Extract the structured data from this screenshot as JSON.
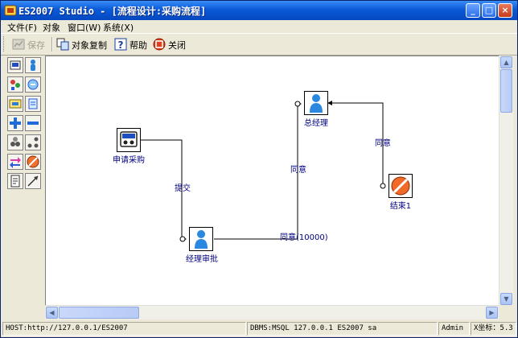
{
  "window": {
    "title": "ES2007 Studio - [流程设计:采购流程]",
    "minimize_glyph": "_",
    "maximize_glyph": "□",
    "close_glyph": "×"
  },
  "menu": [
    "文件(F)",
    "对象",
    "窗口(W)",
    "系统(X)"
  ],
  "toolbar": {
    "save": {
      "label": "保存",
      "icon": "save-icon",
      "enabled": false
    },
    "copy": {
      "label": "对象复制",
      "icon": "copy-icon"
    },
    "help": {
      "label": "帮助",
      "icon": "help-icon"
    },
    "close": {
      "label": "关闭",
      "icon": "close-doc-icon"
    }
  },
  "palette_tools": [
    "start-node-icon",
    "person-node-icon",
    "parallel-node-icon",
    "merge-node-icon",
    "subprocess-node-icon",
    "document-node-icon",
    "add-icon",
    "remove-icon",
    "group-icon",
    "branch-icon",
    "route-icon",
    "end-node-icon",
    "note-icon",
    "connector-tool-icon"
  ],
  "flow": {
    "nodes": {
      "apply": {
        "label": "申请采购",
        "icon": "purchase-request-icon"
      },
      "manager": {
        "label": "经理审批",
        "icon": "person-icon"
      },
      "gm": {
        "label": "总经理",
        "icon": "person-icon"
      },
      "end": {
        "label": "结束1",
        "icon": "end-icon"
      }
    },
    "edges": {
      "submit": "提交",
      "agree_10000": "同意(10000)",
      "agree_gm": "同意",
      "agree_end": "同意"
    }
  },
  "statusbar": {
    "host": "HOST:http://127.0.0.1/ES2007",
    "dbms": "DBMS:MSQL 127.0.0.1 ES2007 sa",
    "user": "Admin",
    "coord": "X坐标：5.3"
  },
  "colors": {
    "title_bar": "#0a5ad8",
    "node_label": "#000080",
    "connector": "#000000",
    "chrome": "#ece9d8"
  }
}
